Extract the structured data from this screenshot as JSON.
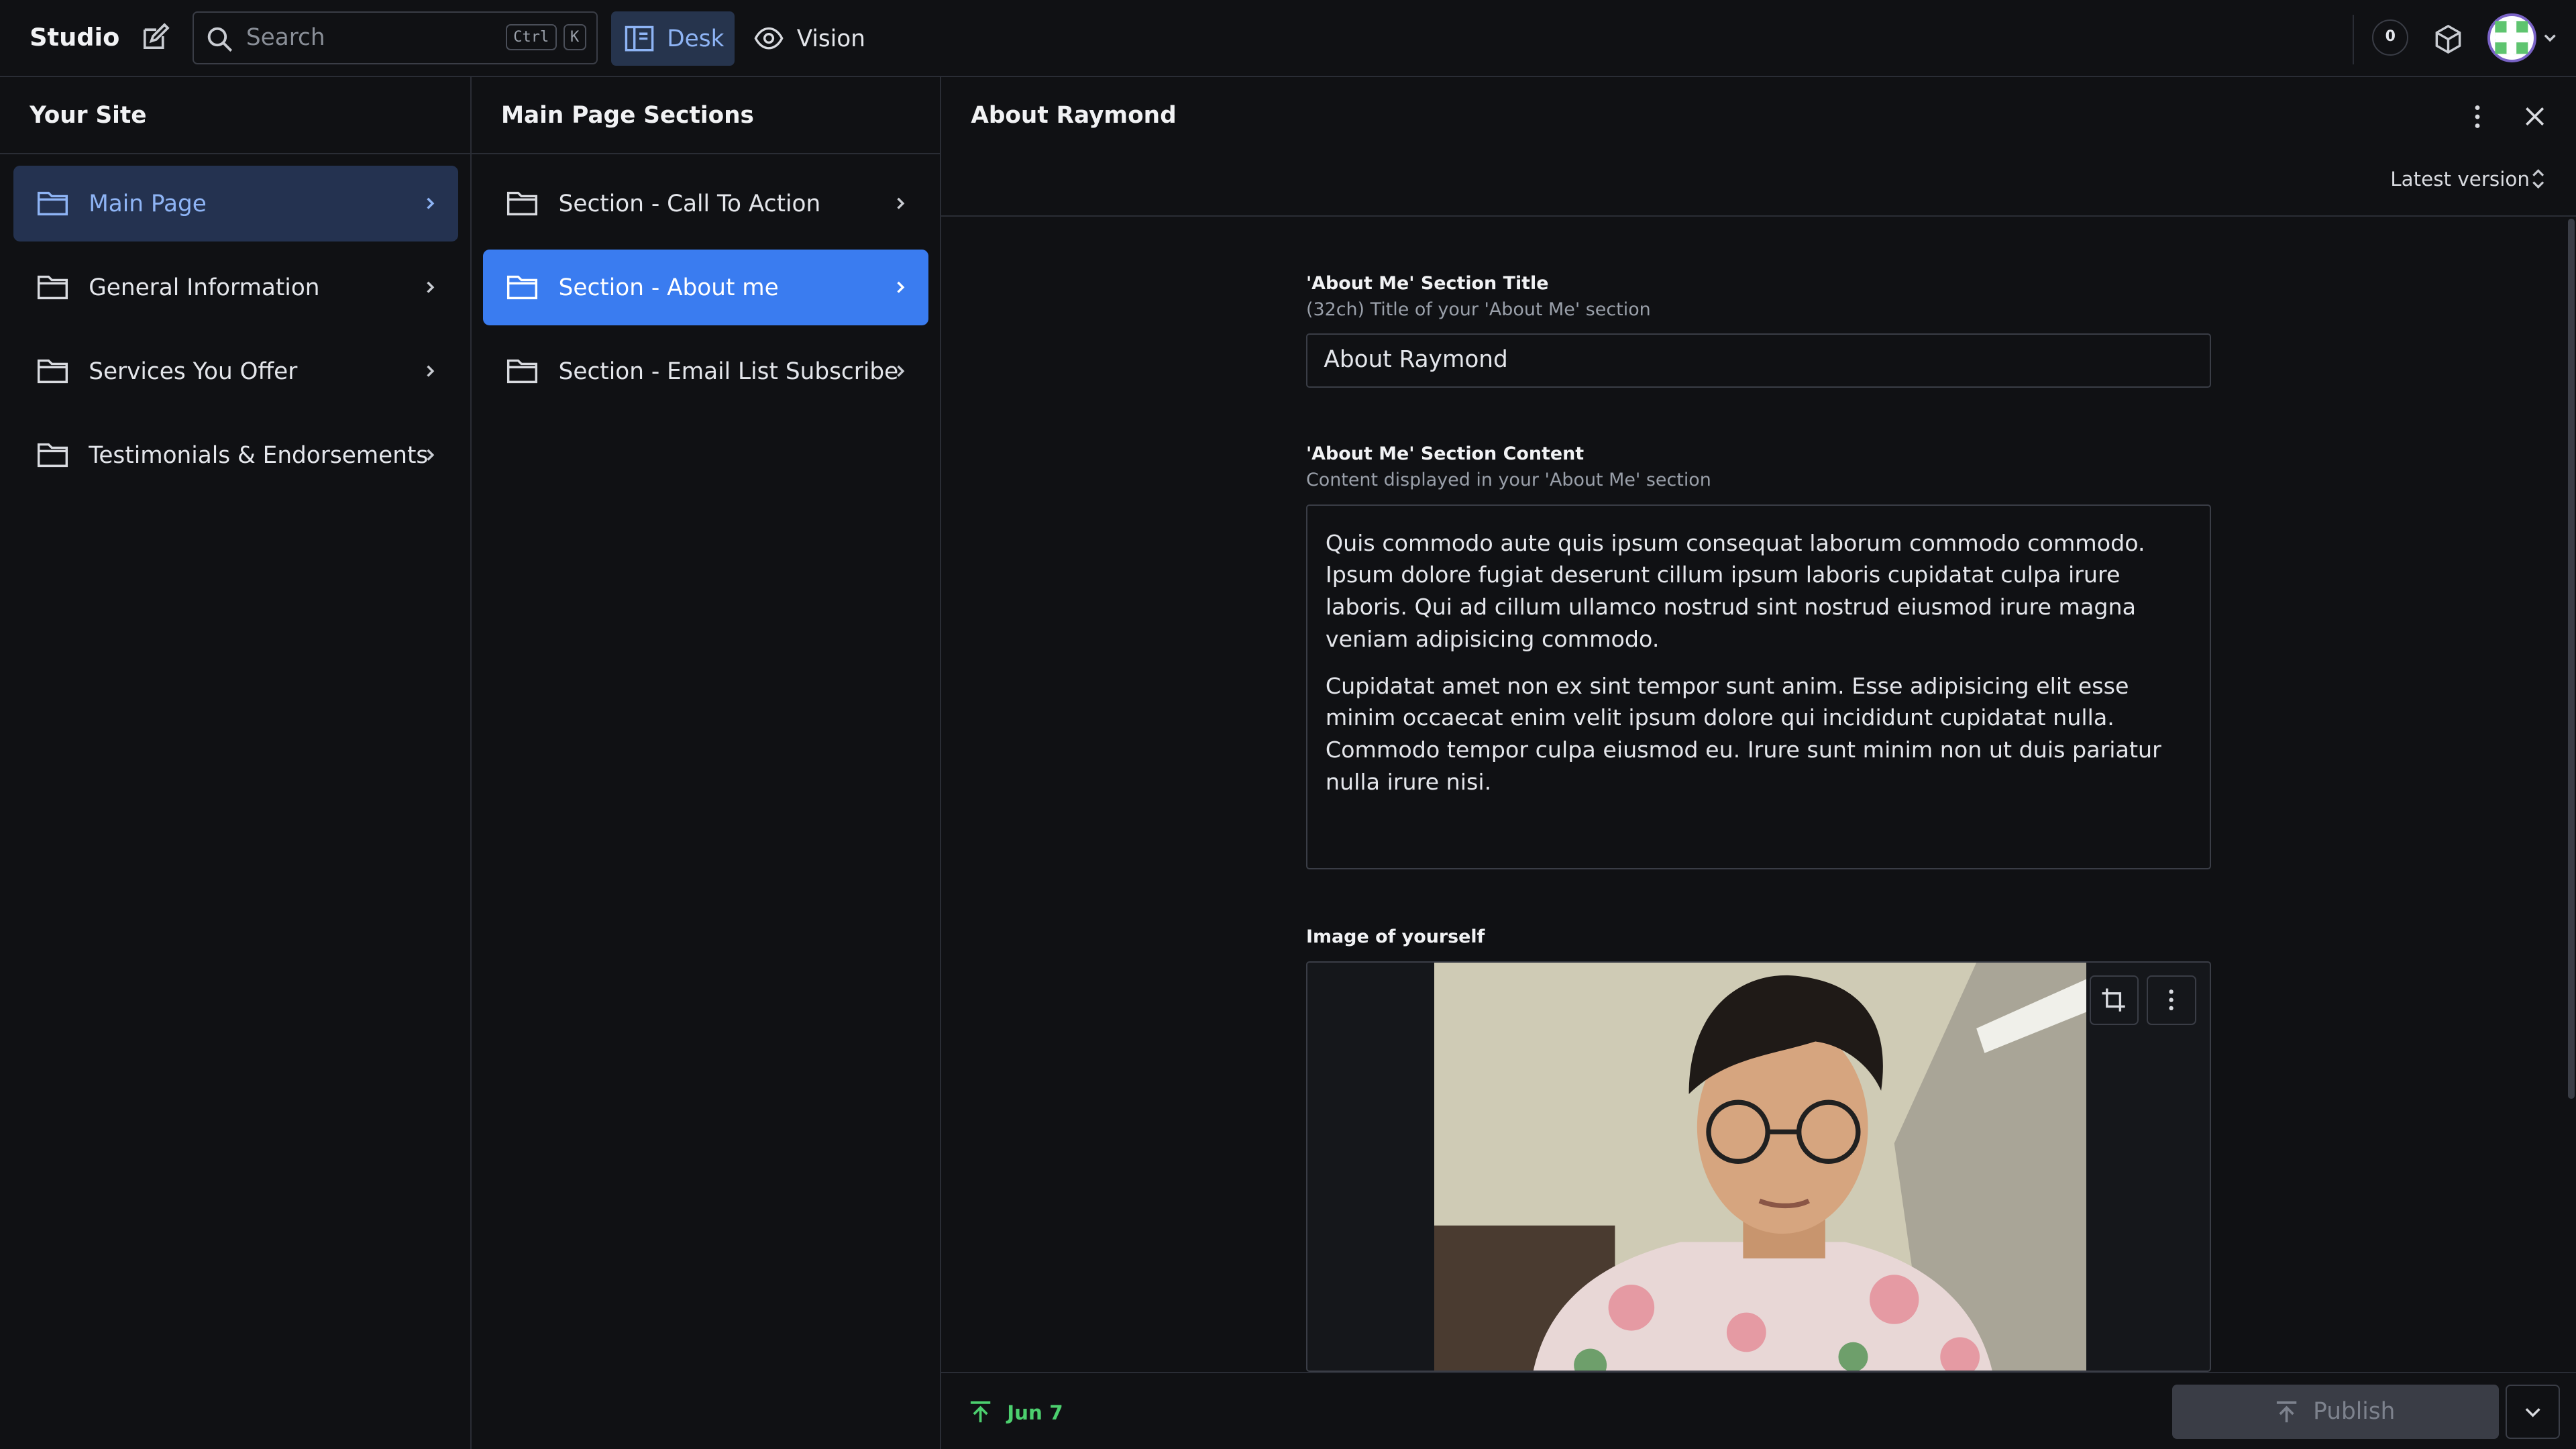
{
  "app": {
    "brand": "Studio"
  },
  "header": {
    "search": {
      "placeholder": "Search",
      "shortcut_ctrl": "Ctrl",
      "shortcut_key": "K"
    },
    "tools": [
      {
        "label": "Desk",
        "icon": "desk-icon",
        "active": true
      },
      {
        "label": "Vision",
        "icon": "eye-icon",
        "active": false
      }
    ],
    "notifications_count": "0",
    "icons": [
      "compose-icon",
      "search-icon",
      "package-icon",
      "avatar",
      "chevron-down-icon"
    ]
  },
  "pane1": {
    "title": "Your Site",
    "items": [
      {
        "label": "Main Page",
        "selected": true
      },
      {
        "label": "General Information",
        "selected": false
      },
      {
        "label": "Services You Offer",
        "selected": false
      },
      {
        "label": "Testimonials & Endorsements",
        "selected": false
      }
    ]
  },
  "pane2": {
    "title": "Main Page Sections",
    "items": [
      {
        "label": "Section - Call To Action",
        "selected": false
      },
      {
        "label": "Section - About me",
        "selected": true
      },
      {
        "label": "Section - Email List Subscribe",
        "selected": false
      }
    ]
  },
  "editor": {
    "title": "About Raymond",
    "version": "Latest version",
    "fields": {
      "title": {
        "label": "'About Me' Section Title",
        "description": "(32ch) Title of your 'About Me' section",
        "value": "About Raymond"
      },
      "content": {
        "label": "'About Me' Section Content",
        "description": "Content displayed in your 'About Me' section",
        "paragraphs": [
          "Quis commodo aute quis ipsum consequat laborum commodo commodo. Ipsum dolore fugiat deserunt cillum ipsum laboris cupidatat culpa irure laboris. Qui ad cillum ullamco nostrud sint nostrud eiusmod irure magna veniam adipisicing commodo.",
          "Cupidatat amet non ex sint tempor sunt anim. Esse adipisicing elit esse minim occaecat enim velit ipsum dolore qui incididunt cupidatat nulla. Commodo tempor culpa eiusmod eu. Irure sunt minim non ut duis pariatur nulla irure nisi."
        ]
      },
      "image": {
        "label": "Image of yourself"
      }
    },
    "footer": {
      "published_date": "Jun 7",
      "publish_label": "Publish"
    }
  },
  "colors": {
    "accent": "#3a7cf0",
    "muted_selection": "#243250",
    "published": "#4ccf6e",
    "background": "#101114"
  }
}
